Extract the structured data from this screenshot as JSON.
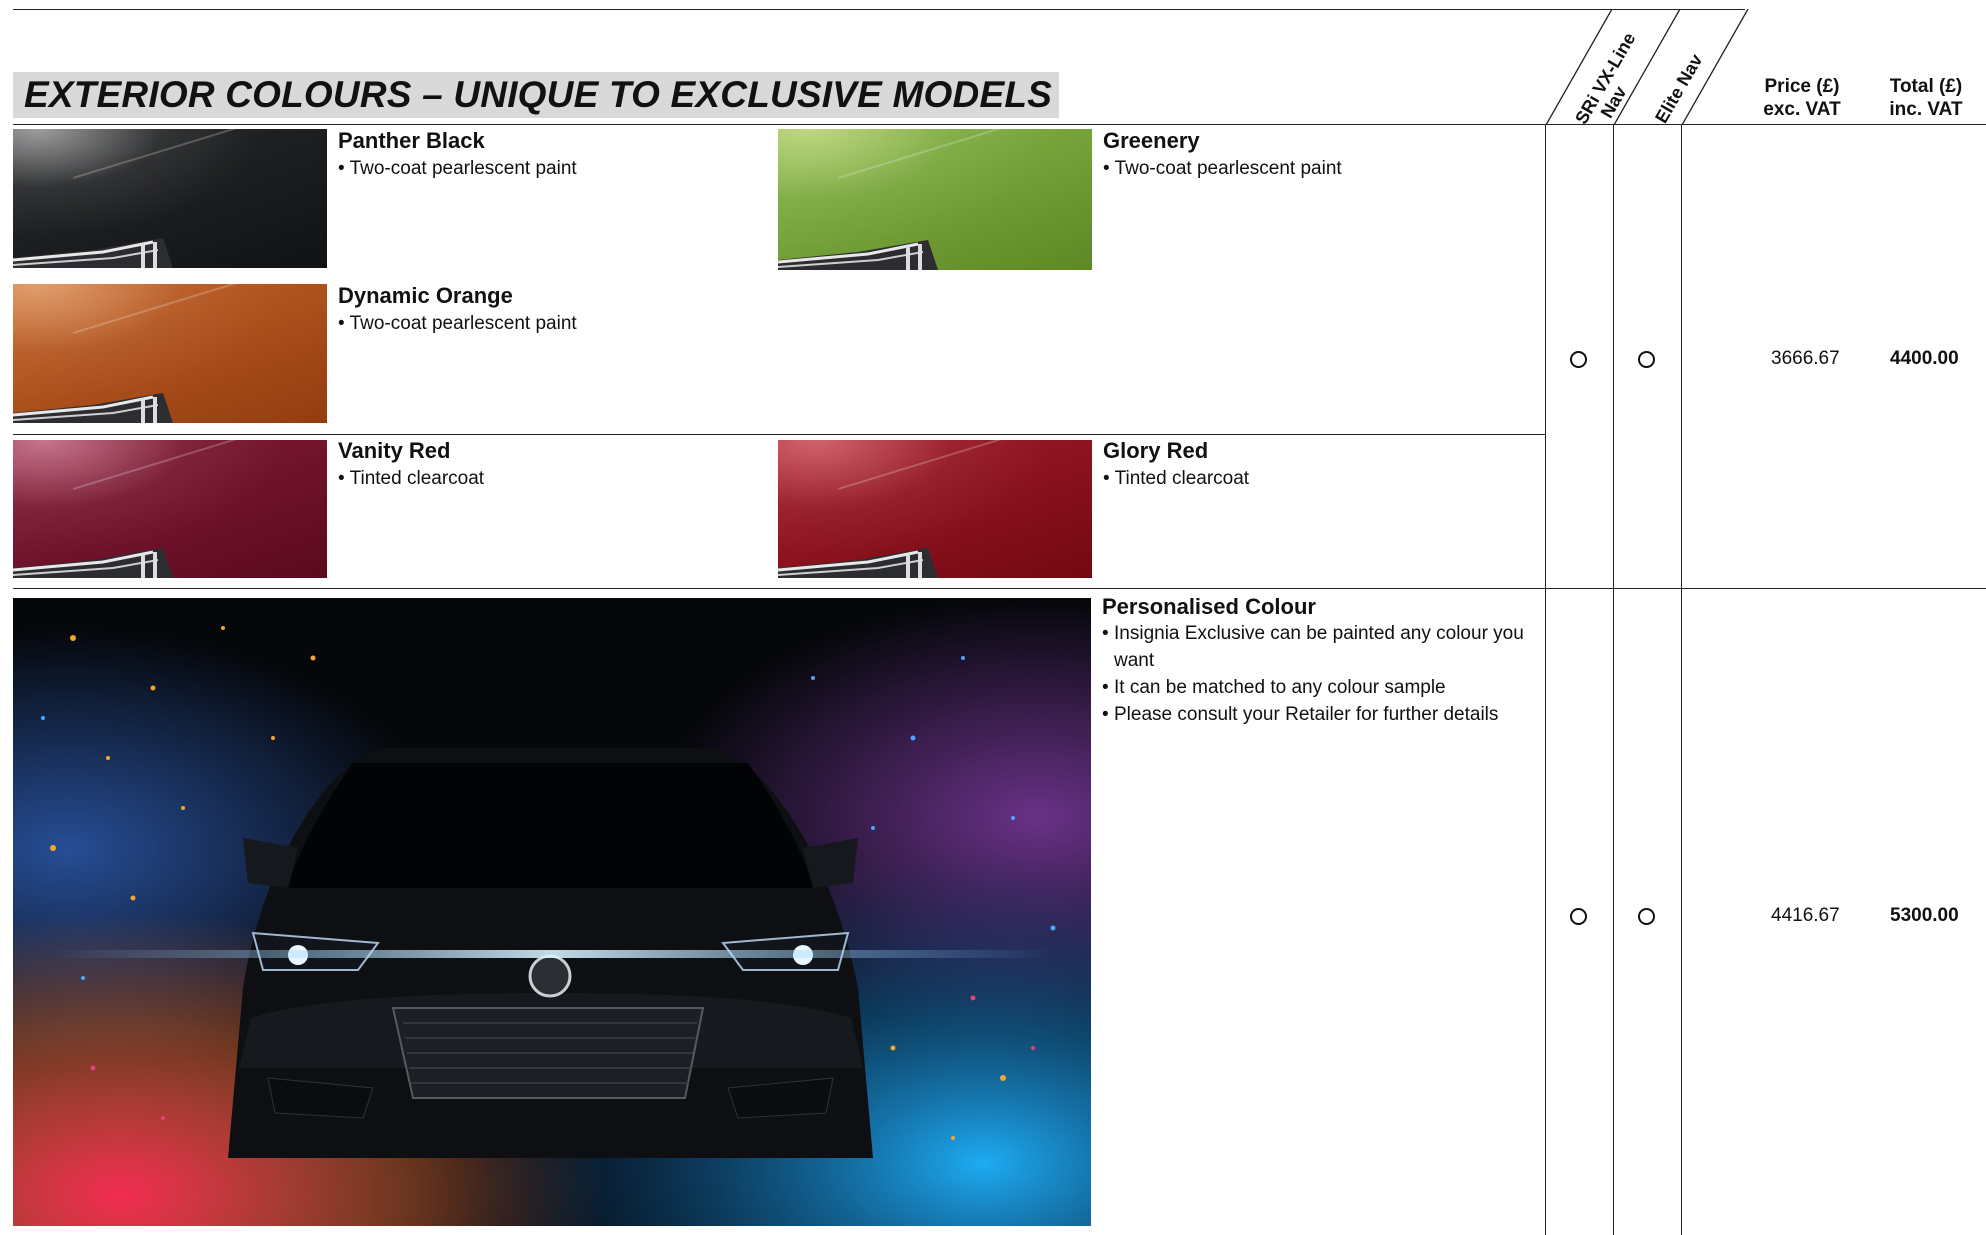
{
  "page": {
    "title": "EXTERIOR COLOURS – UNIQUE TO EXCLUSIVE MODELS"
  },
  "columns": {
    "trim1": "SRi VX-Line Nav",
    "trim1_line1": "SRi VX-Line",
    "trim1_line2": "Nav",
    "trim2": "Elite Nav",
    "price_line1": "Price (£)",
    "price_line2": "exc. VAT",
    "total_line1": "Total (£)",
    "total_line2": "inc. VAT"
  },
  "groups": [
    {
      "colours": [
        {
          "name": "Panther Black",
          "description": "• Two-coat pearlescent paint",
          "swatch_color": "#1a1c1e"
        },
        {
          "name": "Greenery",
          "description": "• Two-coat pearlescent paint",
          "swatch_color": "#7fb23a"
        },
        {
          "name": "Dynamic Orange",
          "description": "• Two-coat pearlescent paint",
          "swatch_color": "#c0581a"
        },
        {
          "name": "Vanity Red",
          "description": "• Tinted clearcoat",
          "swatch_color": "#7d0f2c"
        },
        {
          "name": "Glory Red",
          "description": "• Tinted clearcoat",
          "swatch_color": "#9e0e1e"
        }
      ],
      "availability": [
        "open-circle",
        "open-circle"
      ],
      "price_exc_vat": "3666.67",
      "total_inc_vat": "4400.00"
    },
    {
      "name": "Personalised Colour",
      "bullets": [
        "Insignia Exclusive can be painted any colour you want",
        "It can be matched to any colour sample",
        "Please consult your Retailer for further details"
      ],
      "availability": [
        "open-circle",
        "open-circle"
      ],
      "price_exc_vat": "4416.67",
      "total_inc_vat": "5300.00"
    }
  ]
}
